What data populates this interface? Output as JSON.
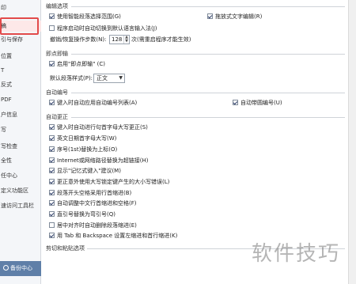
{
  "sidebar": {
    "items": [
      "印",
      "稿",
      "引与保存",
      "位置",
      "T",
      "反式",
      "PDF",
      "户信息",
      "写",
      "写检查",
      "全性",
      "任中心",
      "定义功能区",
      "速访问工具栏"
    ],
    "backup_label": "备份中心"
  },
  "edit_options": {
    "title": "编辑选项",
    "smart_select": "使用智能段落选择范围(G)",
    "drag_edit": "拖放式文字编辑(R)",
    "auto_switch_ime": "程序启动时自动切换到默认语言输入法(J)",
    "undo_steps_label": "撤销/恢复操作步数(N):",
    "undo_steps_value": "128",
    "undo_steps_suffix": "次(需重启程序才能生效)"
  },
  "instant_typeset": {
    "title": "即点即输",
    "enable": "启用\"即点即输\" (C)",
    "default_style_label": "默认段落样式(P):",
    "default_style_value": "正文"
  },
  "auto_numbering": {
    "title": "自动编号",
    "apply_on_type": "键入时自动应用自动编号列表(A)",
    "auto_bullets": "自动带圆编号(U)"
  },
  "autocorrect": {
    "title": "自动更正",
    "items": [
      "键入时自动进行句首字母大写更正(S)",
      "英文日期首字母大写(W)",
      "序号(1st)替换为上标(O)",
      "Internet或网络路径替换为超链接(H)",
      "显示\"记忆式键入\"建议(M)",
      "更正意外使用大写锁定键产生的大小写错误(L)",
      "段落开头空格采用行首缩进(B)",
      "自动调整中文行首缩进和空格(F)",
      "直引号替换为弯引号(Q)",
      "居中对齐时自动删除段落缩进(E)",
      "用 Tab 和 Backspace 设置左缩进和首行缩进(K)"
    ]
  },
  "cut_paste": {
    "title": "剪切和粘贴选项"
  },
  "watermark": "软件技巧"
}
